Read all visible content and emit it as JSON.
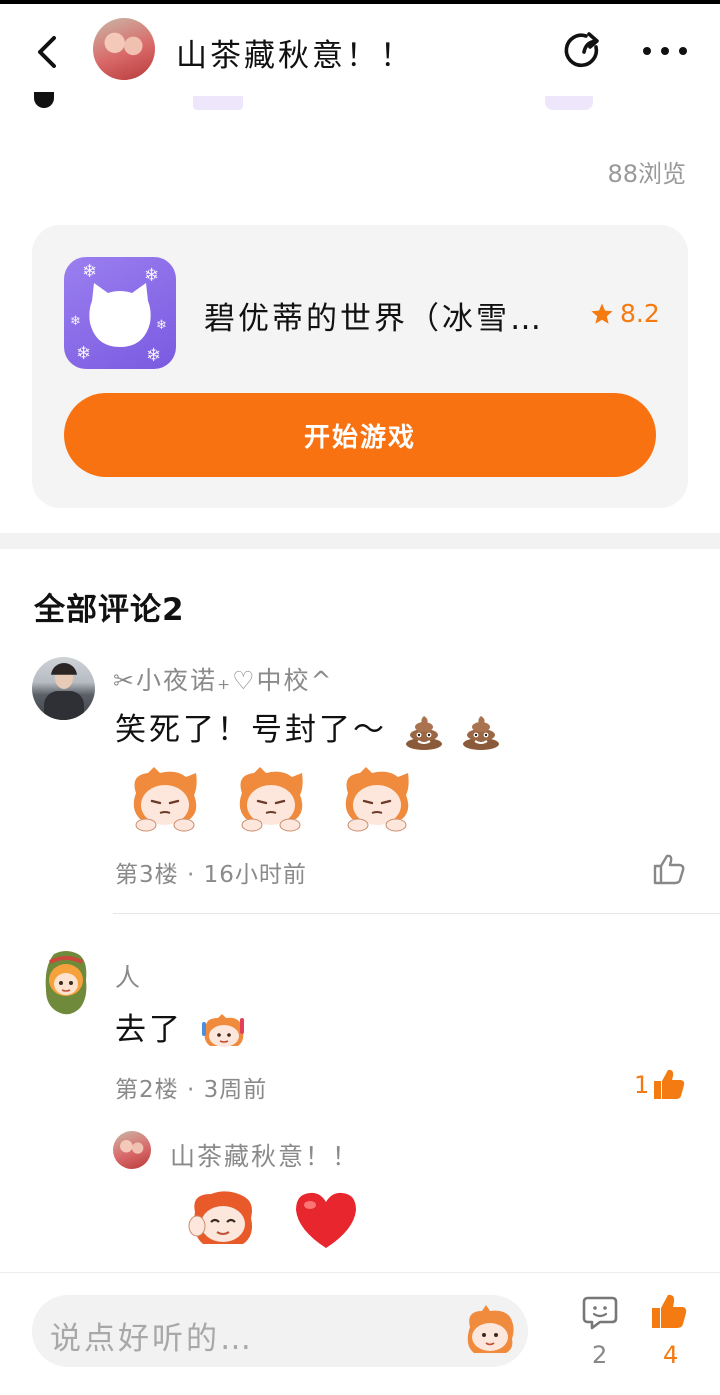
{
  "header": {
    "title": "山茶藏秋意！！",
    "back_icon": "back-arrow-icon",
    "share_icon": "share-icon",
    "more_icon": "more-icon"
  },
  "post": {
    "views": "88浏览"
  },
  "game": {
    "name": "碧优蒂的世界（冰雪…",
    "rating": "8.2",
    "play_label": "开始游戏",
    "accent": "#f97212",
    "icon_color": "#8c6cf0"
  },
  "comments_section": {
    "title": "全部评论2",
    "comments": [
      {
        "author": "✂小夜诺₊♡中校^",
        "text": "笑死了！号封了～",
        "emojis": [
          "poop-emoji",
          "poop-emoji"
        ],
        "stickers": [
          "sticker-sad",
          "sticker-sad",
          "sticker-sad"
        ],
        "meta": "第3楼 · 16小时前",
        "likes": ""
      },
      {
        "author": "人",
        "text": "去了",
        "meta": "第2楼 · 3周前",
        "likes": "1",
        "reply": {
          "author": "山茶藏秋意！！",
          "stickers": [
            "sticker-wave",
            "heart-sticker"
          ]
        }
      }
    ]
  },
  "bottom_bar": {
    "placeholder": "说点好听的…",
    "comment_count": "2",
    "like_count": "4"
  }
}
